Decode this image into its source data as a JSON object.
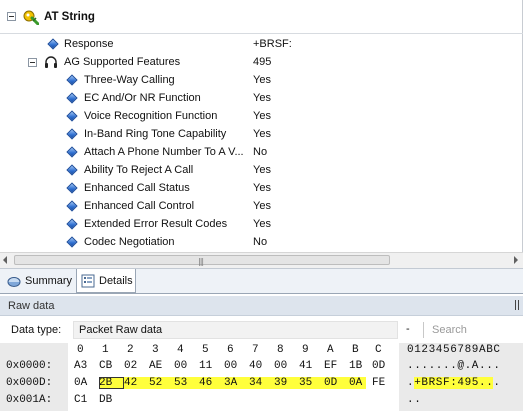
{
  "tree": {
    "header_title": "AT String",
    "rows": [
      {
        "label": "Response",
        "value": "+BRSF:"
      },
      {
        "label": "AG Supported Features",
        "value": "495"
      },
      {
        "label": "Three-Way Calling",
        "value": "Yes"
      },
      {
        "label": "EC And/Or NR Function",
        "value": "Yes"
      },
      {
        "label": "Voice Recognition Function",
        "value": "Yes"
      },
      {
        "label": "In-Band Ring Tone Capability",
        "value": "Yes"
      },
      {
        "label": "Attach A Phone Number To A V...",
        "value": "No"
      },
      {
        "label": "Ability To Reject A Call",
        "value": "Yes"
      },
      {
        "label": "Enhanced Call Status",
        "value": "Yes"
      },
      {
        "label": "Enhanced Call Control",
        "value": "Yes"
      },
      {
        "label": "Extended Error Result Codes",
        "value": "Yes"
      },
      {
        "label": "Codec Negotiation",
        "value": "No"
      }
    ]
  },
  "tabs": {
    "summary": "Summary",
    "details": "Details"
  },
  "raw_data": {
    "title": "Raw data",
    "data_type_label": "Data type:",
    "data_type_value": "Packet Raw data",
    "minus": "-",
    "search_placeholder": "Search",
    "hex_columns": [
      "0",
      "1",
      "2",
      "3",
      "4",
      "5",
      "6",
      "7",
      "8",
      "9",
      "A",
      "B",
      "C"
    ],
    "ascii_header": "0123456789ABC",
    "rows": [
      {
        "address": "0x0000:",
        "bytes": [
          "A3",
          "CB",
          "02",
          "AE",
          "00",
          "11",
          "00",
          "40",
          "00",
          "41",
          "EF",
          "1B",
          "0D"
        ],
        "ascii": ".......@.A..."
      },
      {
        "address": "0x000D:",
        "bytes": [
          "0A",
          "2B",
          "42",
          "52",
          "53",
          "46",
          "3A",
          "34",
          "39",
          "35",
          "0D",
          "0A",
          "FE"
        ],
        "ascii": ".+BRSF:495..."
      },
      {
        "address": "0x001A:",
        "bytes": [
          "C1",
          "DB"
        ],
        "ascii": ".."
      }
    ]
  },
  "colors": {
    "highlight": "#ffff3c",
    "accent": "#2f6fd0"
  }
}
